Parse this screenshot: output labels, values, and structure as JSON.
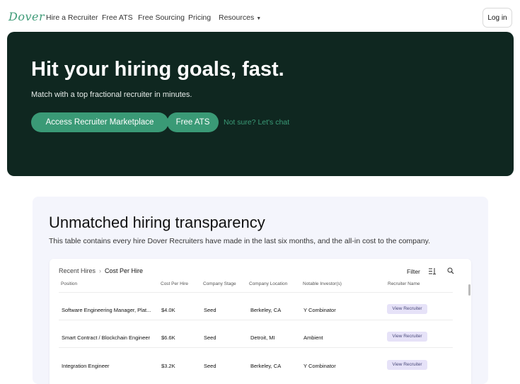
{
  "nav": {
    "logo": "Dover",
    "links": [
      "Hire a Recruiter",
      "Free ATS",
      "Free Sourcing",
      "Pricing",
      "Resources"
    ],
    "login_label": "Log in"
  },
  "hero": {
    "title": "Hit your hiring goals, fast.",
    "subtitle": "Match with a top fractional recruiter in minutes.",
    "primary_button": "Access Recruiter Marketplace",
    "secondary_button": "Free ATS",
    "chat_link": "Not sure? Let's chat",
    "background_color": "#0f2720",
    "accent_color": "#3a9a76"
  },
  "transparency": {
    "title": "Unmatched hiring transparency",
    "subtitle": "This table contains every hire Dover Recruiters have made in the last six months, and the all-in cost to the company.",
    "breadcrumb": [
      "Recent Hires",
      "Cost Per Hire"
    ],
    "filter_label": "Filter",
    "columns": [
      "Position",
      "Cost Per Hire",
      "Company Stage",
      "Company Location",
      "Notable Investor(s)",
      "Recruiter Name"
    ],
    "rows": [
      {
        "position": "Software Engineering Manager, Plat...",
        "cost": "$4.0K",
        "stage": "Seed",
        "location": "Berkeley, CA",
        "investor": "Y Combinator",
        "action": "View Recruiter"
      },
      {
        "position": "Smart Contract / Blockchain Engineer",
        "cost": "$6.6K",
        "stage": "Seed",
        "location": "Detroit, MI",
        "investor": "Ambient",
        "action": "View Recruiter"
      },
      {
        "position": "Integration Engineer",
        "cost": "$3.2K",
        "stage": "Seed",
        "location": "Berkeley, CA",
        "investor": "Y Combinator",
        "action": "View Recruiter"
      }
    ]
  }
}
